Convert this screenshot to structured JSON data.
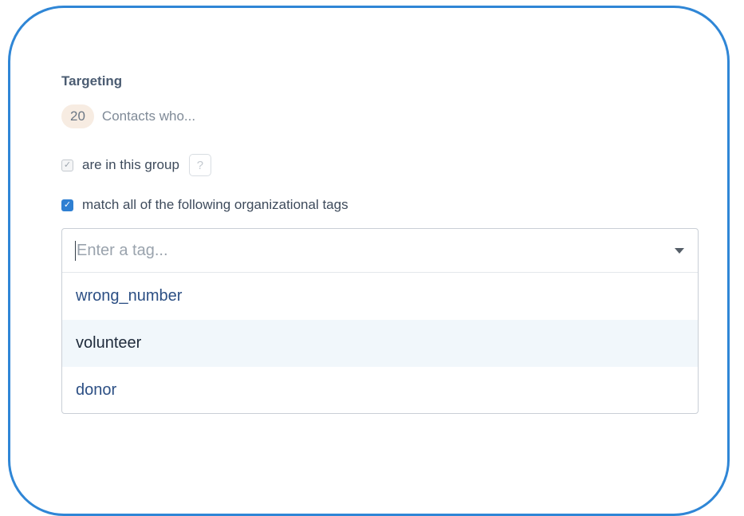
{
  "colors": {
    "frame_border": "#2f86d6",
    "checkbox_checked": "#2e7fd2",
    "option_text": "#2c4f84",
    "highlight_bg": "#f1f7fb"
  },
  "targeting": {
    "title": "Targeting",
    "contact_count": "20",
    "contact_text": "Contacts who...",
    "group_option": {
      "label": "are in this group",
      "checked": true,
      "disabled": true,
      "check_glyph": "✓",
      "help_glyph": "?"
    },
    "tags_option": {
      "label": "match all of the following organizational tags",
      "checked": true,
      "check_glyph": "✓"
    },
    "tag_select": {
      "placeholder": "Enter a tag...",
      "icon": "chevron-down-icon",
      "options": [
        {
          "label": "wrong_number",
          "highlighted": false
        },
        {
          "label": "volunteer",
          "highlighted": true
        },
        {
          "label": "donor",
          "highlighted": false
        }
      ]
    }
  }
}
